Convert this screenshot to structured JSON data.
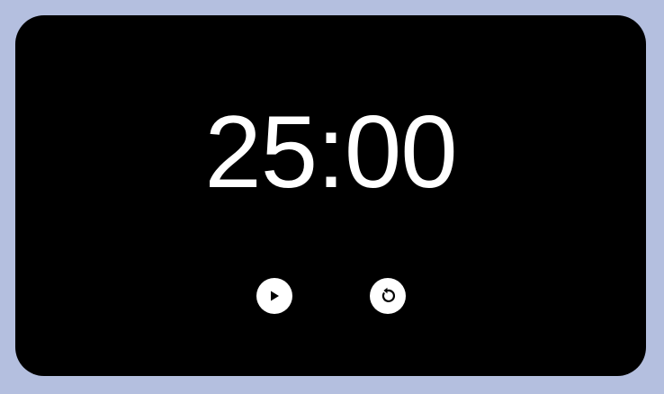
{
  "timer": {
    "time": "25:00"
  },
  "controls": {
    "play": {
      "icon": "play-icon"
    },
    "reset": {
      "icon": "reset-icon"
    }
  },
  "colors": {
    "background": "#b4bfdf",
    "card": "#000000",
    "text": "#ffffff",
    "button": "#ffffff",
    "icon": "#000000"
  }
}
